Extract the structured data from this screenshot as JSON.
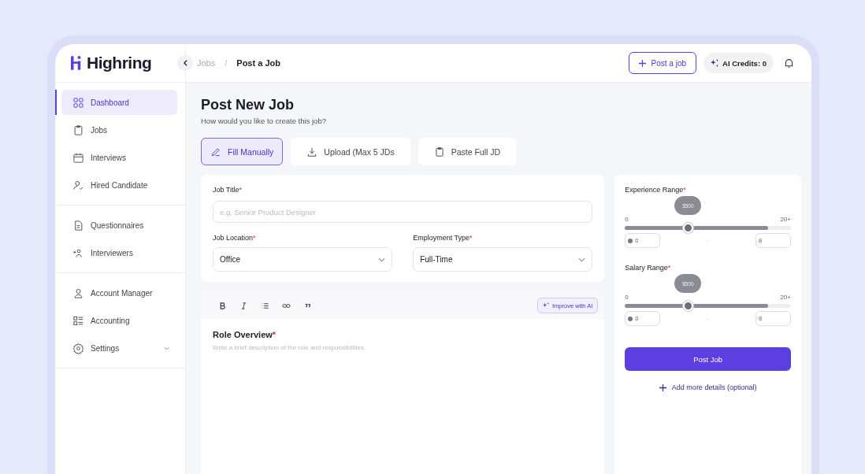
{
  "brand": {
    "name": "Highring"
  },
  "sidebar": {
    "groups": [
      [
        {
          "label": "Dashboard",
          "selected": true
        },
        {
          "label": "Jobs",
          "selected": false
        },
        {
          "label": "Interviews",
          "selected": false
        },
        {
          "label": "Hired Candidate",
          "selected": false
        }
      ],
      [
        {
          "label": "Questionnaires",
          "selected": false
        },
        {
          "label": "Interviewers",
          "selected": false
        }
      ],
      [
        {
          "label": "Account Manager",
          "selected": false
        },
        {
          "label": "Accounting",
          "selected": false
        },
        {
          "label": "Settings",
          "selected": false,
          "expandable": true
        }
      ]
    ]
  },
  "breadcrumb": {
    "items": [
      "Jobs",
      "Post a Job"
    ],
    "separator": "/"
  },
  "header": {
    "post_button": "Post a job",
    "credits": "AI Credits: 0"
  },
  "page": {
    "title": "Post New Job",
    "subtitle": "How would you like to create this job?"
  },
  "modes": [
    {
      "label": "Fill Manually",
      "selected": true
    },
    {
      "label": "Upload (Max 5 JDs",
      "selected": false
    },
    {
      "label": "Paste Full JD",
      "selected": false
    }
  ],
  "form": {
    "job_title": {
      "label": "Job Title",
      "required_mark": "*",
      "placeholder": "e.g. Senior Product Designer"
    },
    "job_location": {
      "label": "Job Location",
      "required_mark": "*",
      "value": "Office"
    },
    "employment_type": {
      "label": "Employment Type",
      "required_mark": "*",
      "value": "Full-Time"
    }
  },
  "editor": {
    "improve_button": "Improve with AI",
    "heading": "Role Overview",
    "required_mark": "*",
    "placeholder": "Write a brief description of the role and responsibilities."
  },
  "ranges": [
    {
      "label": "Experience Range",
      "required_mark": "*",
      "min_label": "0",
      "max_label": "20+",
      "level": 0.86,
      "handle": {
        "level": 0.38,
        "tooltip": "$500"
      },
      "min_value": "0",
      "separator": "-",
      "max_value": "8"
    },
    {
      "label": "Salary Range",
      "required_mark": "*",
      "min_label": "0",
      "max_label": "20+",
      "level": 0.86,
      "handle": {
        "level": 0.38,
        "tooltip": "$500"
      },
      "min_value": "0",
      "separator": "-",
      "max_value": "8"
    }
  ],
  "submit": "Post Job",
  "more_link": "Add more details (optional)"
}
